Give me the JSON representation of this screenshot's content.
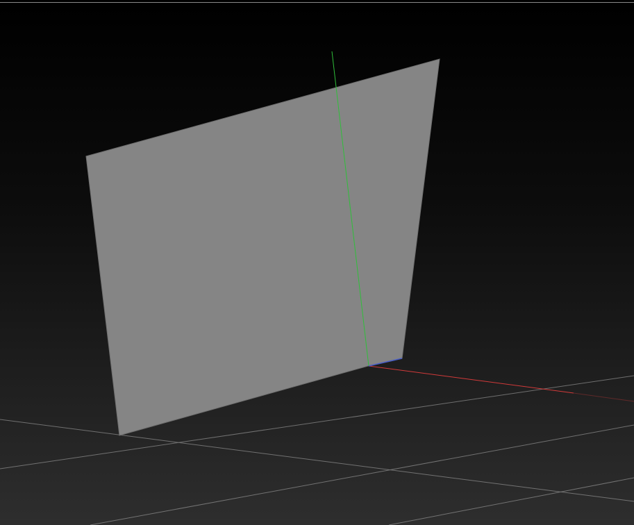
{
  "viewport": {
    "background_top_color": "#000000",
    "background_bottom_color": "#2e2e2e",
    "top_rule_color": "#8a8a8a"
  },
  "grid": {
    "visible": true,
    "line_color": "#9a9a9a"
  },
  "plane": {
    "fill_color": "#858585",
    "edge_color": "#6f6f6f"
  },
  "axes": {
    "x_axis_color": "#d23a3a",
    "y_axis_color": "#2fbf3a",
    "z_axis_color": "#4a5fc8"
  }
}
